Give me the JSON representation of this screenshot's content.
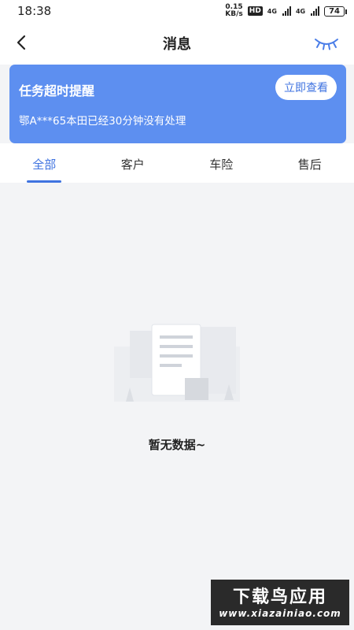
{
  "status_bar": {
    "time": "18:38",
    "net_speed_value": "0.15",
    "net_speed_unit": "KB/s",
    "hd_label": "HD",
    "network_1": "4G",
    "network_2": "4G",
    "battery": "74"
  },
  "header": {
    "title": "消息"
  },
  "alert": {
    "title": "任务超时提醒",
    "message": "鄂A***65本田已经30分钟没有处理",
    "button_label": "立即查看"
  },
  "tabs": [
    {
      "label": "全部",
      "active": true
    },
    {
      "label": "客户",
      "active": false
    },
    {
      "label": "车险",
      "active": false
    },
    {
      "label": "售后",
      "active": false
    }
  ],
  "empty_state": {
    "text": "暂无数据~"
  },
  "watermark": {
    "main": "下载鸟应用",
    "sub": "www.xiazainiao.com"
  },
  "colors": {
    "accent": "#3f73e0",
    "alert_bg": "#5d8ff0",
    "page_bg": "#f3f4f6"
  }
}
